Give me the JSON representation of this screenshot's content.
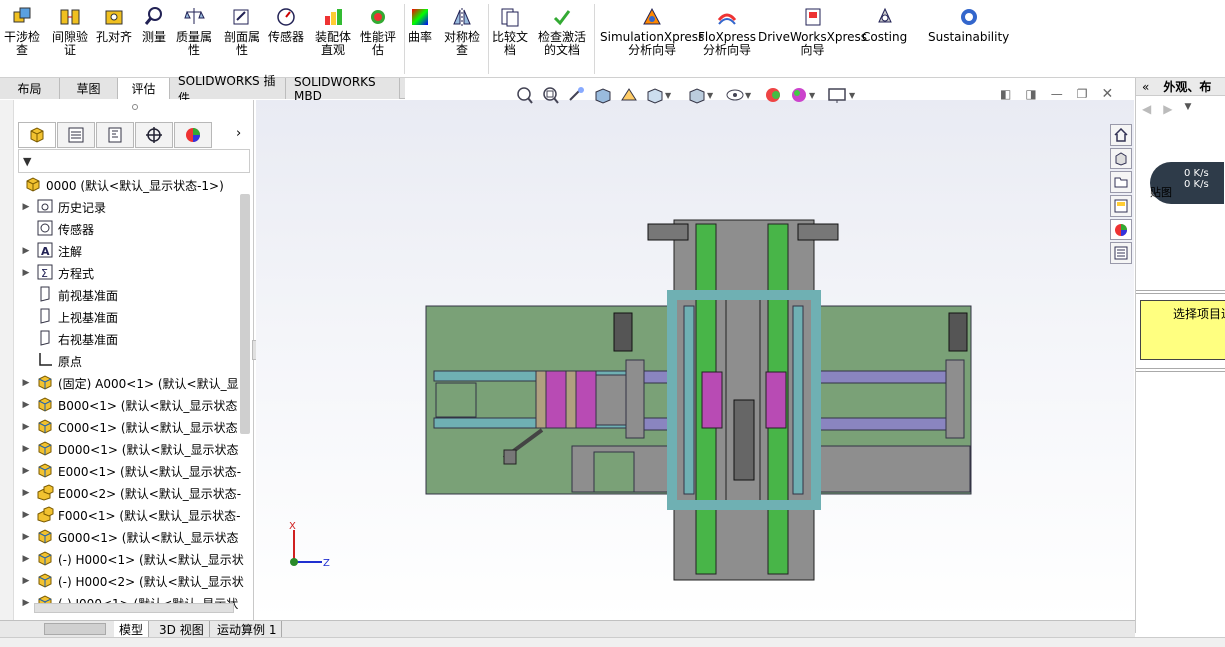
{
  "ribbon": {
    "buttons": [
      {
        "label1": "干涉检",
        "label2": "查",
        "icon": "interference-icon"
      },
      {
        "label1": "间隙验",
        "label2": "证",
        "icon": "clearance-icon"
      },
      {
        "label1": "孔对齐",
        "label2": "",
        "icon": "hole-align-icon"
      },
      {
        "label1": "测量",
        "label2": "",
        "icon": "measure-icon"
      },
      {
        "label1": "质量属",
        "label2": "性",
        "icon": "mass-properties-icon"
      },
      {
        "label1": "剖面属",
        "label2": "性",
        "icon": "section-properties-icon"
      },
      {
        "label1": "传感器",
        "label2": "",
        "icon": "sensor-icon"
      },
      {
        "label1": "装配体",
        "label2": "直观",
        "icon": "assembly-visualization-icon"
      },
      {
        "label1": "性能评",
        "label2": "估",
        "icon": "performance-icon"
      },
      {
        "label1": "曲率",
        "label2": "",
        "icon": "curvature-icon"
      },
      {
        "label1": "对称检",
        "label2": "查",
        "icon": "symmetry-icon"
      },
      {
        "label1": "比较文",
        "label2": "档",
        "icon": "compare-icon"
      },
      {
        "label1": "检查激活",
        "label2": "的文档",
        "icon": "check-icon"
      },
      {
        "label1": "SimulationXpress",
        "label2": "分析向导",
        "icon": "simulation-icon"
      },
      {
        "label1": "FloXpress",
        "label2": "分析向导",
        "icon": "floxpress-icon"
      },
      {
        "label1": "DriveWorksXpress",
        "label2": "向导",
        "icon": "driveworks-icon"
      },
      {
        "label1": "Costing",
        "label2": "",
        "icon": "costing-icon"
      },
      {
        "label1": "Sustainability",
        "label2": "",
        "icon": "sustainability-icon"
      }
    ]
  },
  "tabs": [
    "布局",
    "草图",
    "评估",
    "SOLIDWORKS 插件",
    "SOLIDWORKS MBD"
  ],
  "tree": {
    "filter_symbol": "▼",
    "rows": [
      {
        "text": "0000  (默认<默认_显示状态-1>)",
        "icon": "assembly-icon",
        "arrow": ""
      },
      {
        "text": "历史记录",
        "icon": "history-icon",
        "arrow": "▶"
      },
      {
        "text": "传感器",
        "icon": "sensor-icon",
        "arrow": ""
      },
      {
        "text": "注解",
        "icon": "annotation-icon",
        "arrow": "▶"
      },
      {
        "text": "方程式",
        "icon": "equation-icon",
        "arrow": "▶"
      },
      {
        "text": "前视基准面",
        "icon": "plane-icon",
        "arrow": ""
      },
      {
        "text": "上视基准面",
        "icon": "plane-icon",
        "arrow": ""
      },
      {
        "text": "右视基准面",
        "icon": "plane-icon",
        "arrow": ""
      },
      {
        "text": "原点",
        "icon": "origin-icon",
        "arrow": ""
      },
      {
        "text": "(固定) A000<1> (默认<默认_显",
        "icon": "part-icon",
        "arrow": "▶"
      },
      {
        "text": "B000<1> (默认<默认_显示状态",
        "icon": "part-icon",
        "arrow": "▶"
      },
      {
        "text": "C000<1> (默认<默认_显示状态",
        "icon": "part-icon",
        "arrow": "▶"
      },
      {
        "text": "D000<1> (默认<默认_显示状态",
        "icon": "part-icon",
        "arrow": "▶"
      },
      {
        "text": "E000<1> (默认<默认_显示状态-",
        "icon": "part-icon",
        "arrow": "▶"
      },
      {
        "text": "E000<2> (默认<默认_显示状态-",
        "icon": "subasm-icon",
        "arrow": "▶"
      },
      {
        "text": "F000<1> (默认<默认_显示状态-",
        "icon": "subasm-icon",
        "arrow": "▶"
      },
      {
        "text": "G000<1> (默认<默认_显示状态",
        "icon": "part-icon",
        "arrow": "▶"
      },
      {
        "text": "(-) H000<1> (默认<默认_显示状",
        "icon": "part-icon",
        "arrow": "▶"
      },
      {
        "text": "(-) H000<2> (默认<默认_显示状",
        "icon": "part-icon",
        "arrow": "▶"
      },
      {
        "text": "(-) I000<1> (默认<默认_显示状",
        "icon": "part-icon",
        "arrow": "▶"
      }
    ]
  },
  "triad": {
    "x": "X",
    "z": "Z"
  },
  "bottom_tabs": [
    "模型",
    "3D 视图",
    "运动算例 1"
  ],
  "right_panel": {
    "title": "外观、布",
    "speed_up": "0 K/s",
    "speed_down": "0 K/s",
    "tooltip": "选择项目进",
    "tree_item": "贴图"
  },
  "colors": {
    "plate": "#7aa177",
    "green_rail": "#48b548",
    "magenta": "#b84bb4",
    "teal": "#6fb0b3",
    "lavender": "#8a85c0",
    "grey": "#8e8e8e",
    "tooltip_bg": "#ffff80"
  }
}
